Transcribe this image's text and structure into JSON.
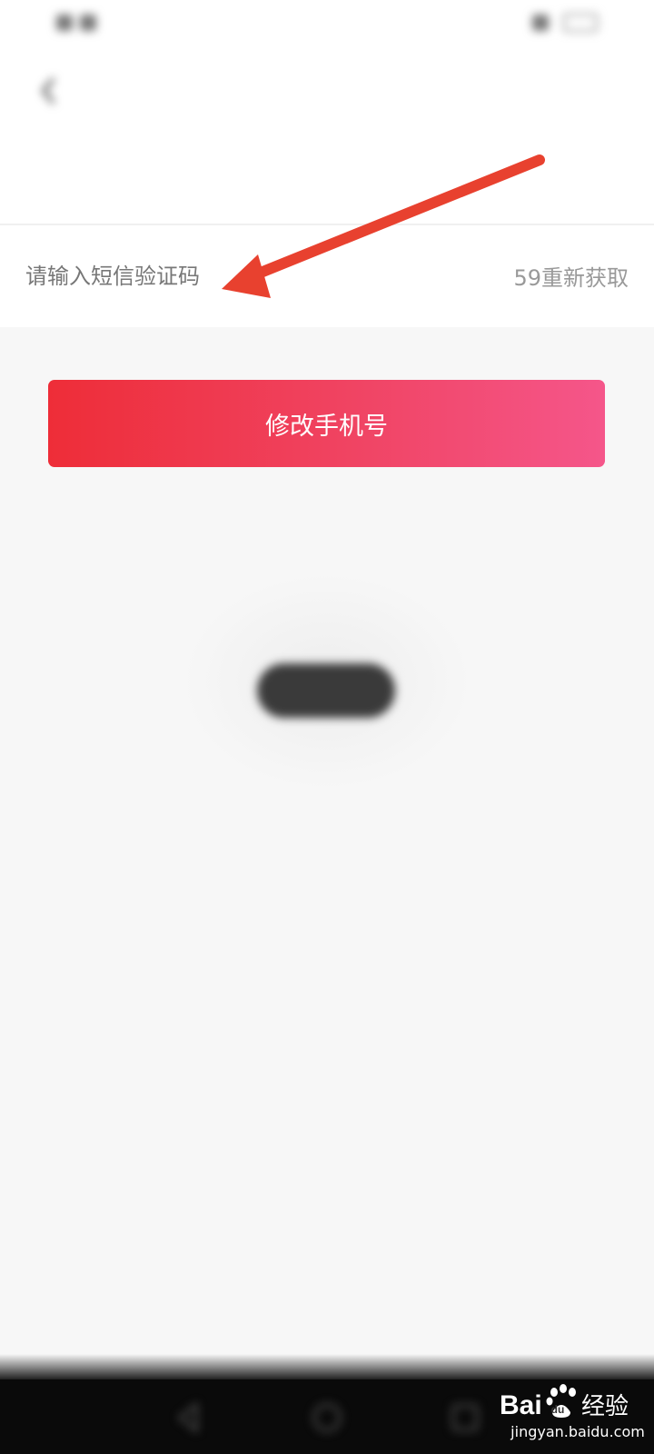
{
  "status_bar": {
    "carrier": "",
    "time": ""
  },
  "nav": {
    "title": "",
    "back_icon": "chevron-left-icon"
  },
  "phone_row": {
    "label": "",
    "value": ""
  },
  "code_row": {
    "placeholder": "请输入短信验证码",
    "resend": "59重新获取"
  },
  "main_button": {
    "label": "修改手机号"
  },
  "toast": {
    "text": ""
  },
  "annotation": {
    "arrow_color": "#e8412f"
  },
  "watermark": {
    "text": "jingyan.baidu.com",
    "logo": "Baidu 经验"
  },
  "colors": {
    "accent_start": "#ee2d38",
    "accent_end": "#f5568a",
    "background": "#f7f7f7"
  }
}
